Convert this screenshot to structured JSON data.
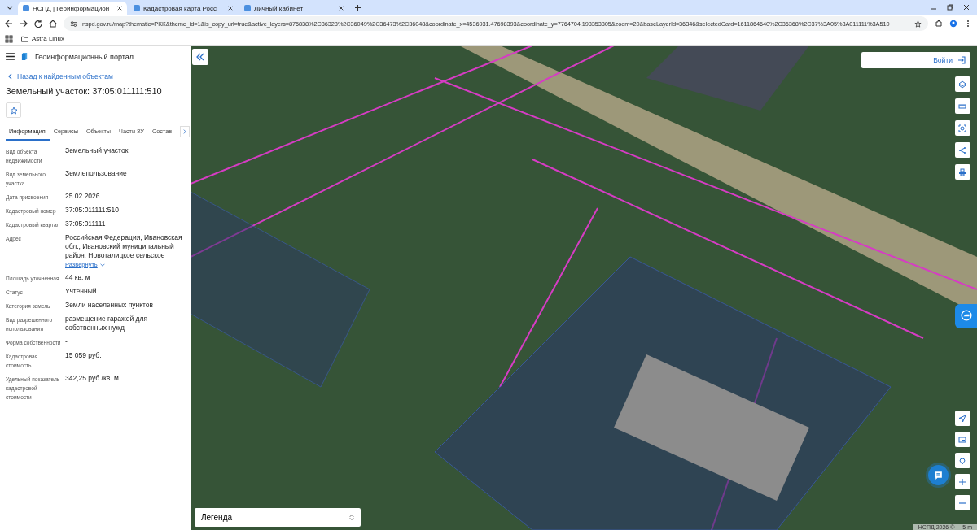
{
  "browser": {
    "tabs": [
      {
        "title": "НСПД | Геоинформацион",
        "selected": true
      },
      {
        "title": "Кадастровая карта Росс",
        "selected": false
      },
      {
        "title": "Личный кабинет",
        "selected": false
      }
    ],
    "url": "nspd.gov.ru/map?thematic=PKK&theme_id=1&is_copy_url=true&active_layers=875838%2C36328%2C36049%2C36473%2C36048&coordinate_x=4536931.47698393&coordinate_y=7764704.198353805&zoom=20&baseLayerId=36346&selectedCard=1611864640%2C36368%2C37%3A05%3A011111%3A510",
    "bookmarks": [
      "Astra Linux"
    ]
  },
  "portal": {
    "title": "Геоинформационный портал",
    "back_link": "Назад к найденным объектам",
    "heading": "Земельный участок: 37:05:011111:510",
    "tabs": [
      {
        "label": "Информация",
        "selected": true
      },
      {
        "label": "Сервисы",
        "selected": false
      },
      {
        "label": "Объекты",
        "selected": false
      },
      {
        "label": "Части ЗУ",
        "selected": false
      },
      {
        "label": "Состав",
        "selected": false
      }
    ],
    "fields": [
      {
        "label": "Вид объекта недвижимости",
        "value": "Земельный участок"
      },
      {
        "label": "Вид земельного участка",
        "value": "Землепользование"
      },
      {
        "label": "Дата присвоения",
        "value": "25.02.2026"
      },
      {
        "label": "Кадастровый номер",
        "value": "37:05:011111:510"
      },
      {
        "label": "Кадастровый квартал",
        "value": "37:05:011111"
      },
      {
        "label": "Адрес",
        "value": "Российская Федерация, Ивановская обл., Ивановский муниципальный район, Новоталицкое сельское",
        "link": "Развернуть"
      },
      {
        "label": "Площадь уточненная",
        "value": "44 кв. м"
      },
      {
        "label": "Статус",
        "value": "Учтенный"
      },
      {
        "label": "Категория земель",
        "value": "Земли населенных пунктов"
      },
      {
        "label": "Вид разрешенного использования",
        "value": "размещение гаражей для собственных нужд"
      },
      {
        "label": "Форма собственности",
        "value": "-"
      },
      {
        "label": "Кадастровая стоимость",
        "value": "15 059 руб."
      },
      {
        "label": "Удельный показатель кадастровой стоимости",
        "value": "342,25 руб./кв. м"
      }
    ]
  },
  "map": {
    "login_button": "Войти",
    "legend": "Легенда",
    "copyright": "НСПД 2026 ©",
    "scale": "5 m"
  }
}
